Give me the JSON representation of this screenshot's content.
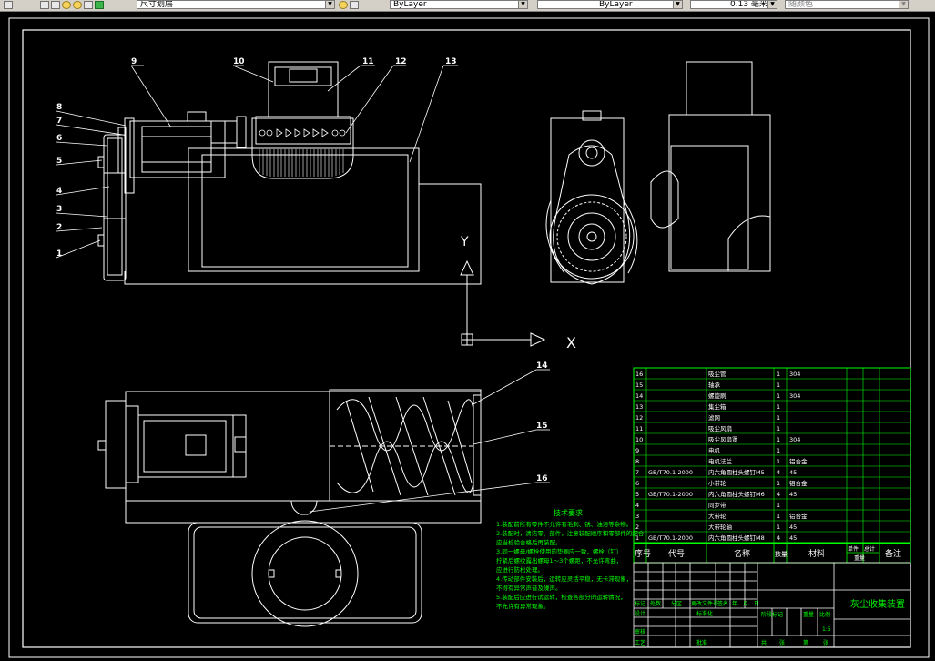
{
  "toolbar": {
    "layer_name": "尺寸划层",
    "linetype": "ByLayer",
    "lineweight": "ByLayer",
    "weight_value": "0.13 毫米",
    "plot_style": "随颜色"
  },
  "colors": {
    "background": "#000000",
    "geometry": "#ffffff",
    "annotation": "#00ff00",
    "ucs": "#ffffff"
  },
  "drawing": {
    "ucs_x": "X",
    "ucs_y": "Y",
    "callouts": [
      "9",
      "10",
      "11",
      "12",
      "13",
      "8",
      "7",
      "6",
      "5",
      "4",
      "3",
      "2",
      "1",
      "14",
      "15",
      "16"
    ]
  },
  "tech_notes": {
    "title": "技术要求",
    "lines": [
      "1.装配前所有零件不允许有毛刺、锈、油污等杂物。",
      "2.装配时，清洁零、部件，注意装配顺序和零部件的配合",
      "  应当检验合格后再装配。",
      "3.同一螺母/螺栓使用的垫圈应一致，螺栓（钉）",
      "  拧紧后螺纹露出螺母1～3个螺距，不允许弯曲，",
      "  应进行防松处理。",
      "4.传动部件安装后，运转应灵活平稳，无卡滞现象，",
      "  不得有异常声音及噪声。",
      "5.装配后应进行试运转，检查各部分的运转情况，",
      "  不允许有异常现象。"
    ]
  },
  "bom": {
    "rows": [
      {
        "no": "16",
        "code": "",
        "name": "吸尘管",
        "qty": "1",
        "mat": "304"
      },
      {
        "no": "15",
        "code": "",
        "name": "轴承",
        "qty": "1",
        "mat": ""
      },
      {
        "no": "14",
        "code": "",
        "name": "螺旋刷",
        "qty": "1",
        "mat": "304"
      },
      {
        "no": "13",
        "code": "",
        "name": "集尘箱",
        "qty": "1",
        "mat": ""
      },
      {
        "no": "12",
        "code": "",
        "name": "滤网",
        "qty": "1",
        "mat": ""
      },
      {
        "no": "11",
        "code": "",
        "name": "吸尘风扇",
        "qty": "1",
        "mat": ""
      },
      {
        "no": "10",
        "code": "",
        "name": "吸尘风扇罩",
        "qty": "1",
        "mat": "304"
      },
      {
        "no": "9",
        "code": "",
        "name": "电机",
        "qty": "1",
        "mat": ""
      },
      {
        "no": "8",
        "code": "",
        "name": "电机法兰",
        "qty": "1",
        "mat": "铝合金"
      },
      {
        "no": "7",
        "code": "GB/T70.1-2000",
        "name": "内六角圆柱头螺钉M5",
        "qty": "4",
        "mat": "45"
      },
      {
        "no": "6",
        "code": "",
        "name": "小带轮",
        "qty": "1",
        "mat": "铝合金"
      },
      {
        "no": "5",
        "code": "GB/T70.1-2000",
        "name": "内六角圆柱头螺钉M6",
        "qty": "4",
        "mat": "45"
      },
      {
        "no": "4",
        "code": "",
        "name": "同步带",
        "qty": "1",
        "mat": ""
      },
      {
        "no": "3",
        "code": "",
        "name": "大带轮",
        "qty": "1",
        "mat": "铝合金"
      },
      {
        "no": "2",
        "code": "",
        "name": "大带轮轴",
        "qty": "1",
        "mat": "45"
      },
      {
        "no": "1",
        "code": "GB/T70.1-2000",
        "name": "内六角圆柱头螺钉M8",
        "qty": "4",
        "mat": "45"
      }
    ],
    "header": {
      "no": "序号",
      "code": "代号",
      "name": "名称",
      "qty": "数量",
      "mat": "材料",
      "single": "单件",
      "total": "总计",
      "weight": "重量",
      "remark": "备注"
    }
  },
  "title_block": {
    "drawing_title": "灰尘收集装置",
    "designer": "设计",
    "standardization": "标准化",
    "reviewer": "审核",
    "process": "工艺",
    "approve": "批准",
    "stage": "阶段标记",
    "weight": "重量",
    "scale": "比例",
    "scale_value": "1:5",
    "mark": "标记",
    "count": "处数",
    "zone": "分区",
    "change_doc": "更改文件号",
    "sign": "签名",
    "date": "年、月、日",
    "total": "共",
    "sheet": "张",
    "page_of": "第",
    "page_sheet": "张"
  }
}
